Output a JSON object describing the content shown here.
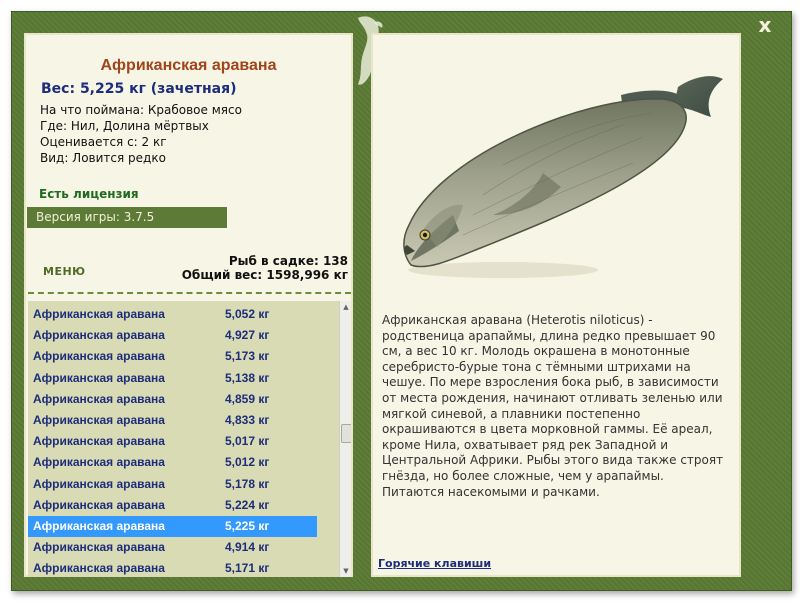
{
  "window": {
    "close_label": "x"
  },
  "fish": {
    "name": "Африканская аравана",
    "weight_line": "Вес: 5,225 кг (зачетная)",
    "bait_line": "На что поймана: Крабовое мясо",
    "location_line": "Где: Нил, Долина мёртвых",
    "rated_line": "Оцениваетcя с: 2 кг",
    "kind_line": "Вид: Ловится редко"
  },
  "status": {
    "license": "Есть лицензия",
    "version": "Версия игры: 3.7.5"
  },
  "menu_label": "МЕНЮ",
  "stats": {
    "fish_in_cage": "Рыб в садке: 138",
    "total_weight": "Общий вес: 1598,996 кг"
  },
  "catch_list": [
    {
      "name": "Африканская аравана",
      "weight": "5,052 кг",
      "selected": false
    },
    {
      "name": "Африканская аравана",
      "weight": "4,927 кг",
      "selected": false
    },
    {
      "name": "Африканская аравана",
      "weight": "5,173 кг",
      "selected": false
    },
    {
      "name": "Африканская аравана",
      "weight": "5,138 кг",
      "selected": false
    },
    {
      "name": "Африканская аравана",
      "weight": "4,859 кг",
      "selected": false
    },
    {
      "name": "Африканская аравана",
      "weight": "4,833 кг",
      "selected": false
    },
    {
      "name": "Африканская аравана",
      "weight": "5,017 кг",
      "selected": false
    },
    {
      "name": "Африканская аравана",
      "weight": "5,012 кг",
      "selected": false
    },
    {
      "name": "Африканская аравана",
      "weight": "5,178 кг",
      "selected": false
    },
    {
      "name": "Африканская аравана",
      "weight": "5,224 кг",
      "selected": false
    },
    {
      "name": "Африканская аравана",
      "weight": "5,225 кг",
      "selected": true
    },
    {
      "name": "Африканская аравана",
      "weight": "4,914 кг",
      "selected": false
    },
    {
      "name": "Африканская аравана",
      "weight": "5,171 кг",
      "selected": false
    }
  ],
  "description": "Африканская аравана (Heterotis niloticus) - родственица арапаймы, длина редко превышает 90 см, а вес 10 кг. Молодь окрашена в монотонные серебристо-бурые тона с тёмными штрихами на чешуе. По мере взросления бока рыб, в зависимости от места рождения, начинают отливать зеленью или мягкой синевой, а плавники постепенно окрашиваются в цвета морковной гаммы. Её ареал, кроме Нила, охватывает ряд рек Западной и Центральной Африки. Рыбы этого вида также строят гнёзда, но более сложные, чем у арапаймы. Питаются насекомыми и рачками.",
  "hotkeys_label": "Горячие клавиши",
  "colors": {
    "frame": "#5a7a34",
    "panel": "#f6f5e6",
    "title": "#a2441a",
    "link": "#1d2d7a",
    "selection": "#3399ff"
  }
}
